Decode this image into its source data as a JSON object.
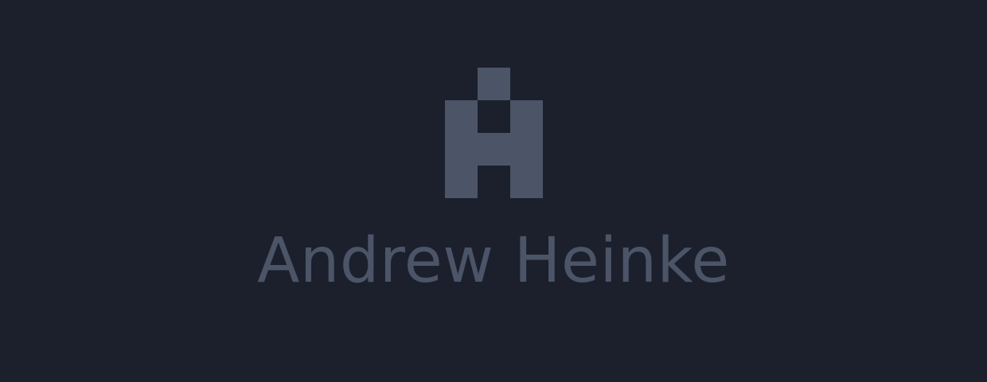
{
  "colors": {
    "background": "#1b202c",
    "brand": "#4b5567"
  },
  "brand": {
    "name": "Andrew Heinke",
    "logo_icon": "pixel-h-monogram-icon"
  }
}
